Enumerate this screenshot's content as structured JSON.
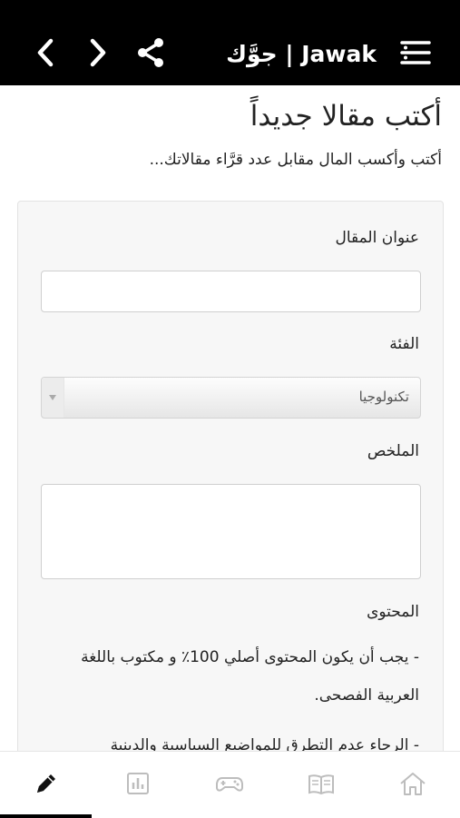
{
  "header": {
    "brand": "جوَّك | Jawak",
    "icons": [
      "back-icon",
      "forward-icon",
      "share-icon",
      "menu-icon"
    ]
  },
  "page": {
    "title": "أكتب مقالا جديداً",
    "subtitle": "أكتب وأكسب المال مقابل عدد قرَّاء مقالاتك..."
  },
  "form": {
    "title_label": "عنوان المقال",
    "title_value": "",
    "category_label": "الفئة",
    "category_selected": "تكنولوجيا",
    "summary_label": "الملخص",
    "summary_value": "",
    "content_label": "المحتوى",
    "rule_1": "- يجب أن يكون المحتوى أصلي 100٪ و مكتوب باللغة العربية الفصحى.",
    "rule_2": "- الرجاء عدم التطرق للمواضيع السياسية والدينية"
  },
  "bottom_nav": {
    "items": [
      "write-icon",
      "stats-icon",
      "games-icon",
      "articles-icon",
      "home-icon"
    ],
    "active": "write-icon"
  },
  "colors": {
    "header_bg": "#000000",
    "card_bg": "#f7f7f7",
    "active_indicator": "#000000",
    "inactive_icon": "#bdbdbd"
  }
}
